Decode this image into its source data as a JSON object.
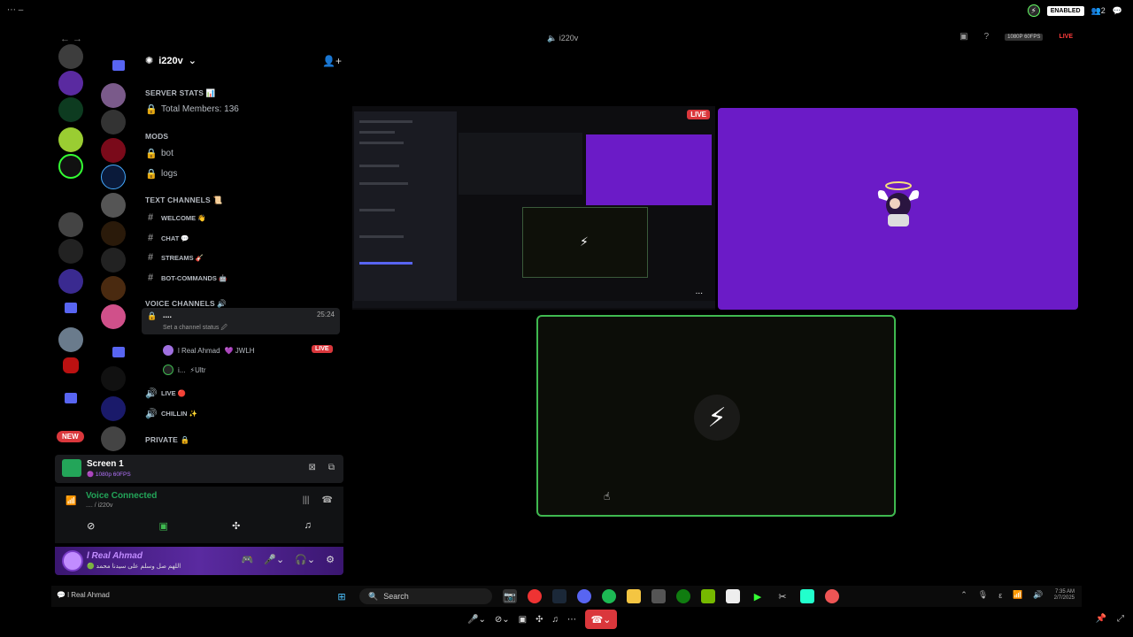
{
  "window": {
    "title": "i220v",
    "fps_badge": "1080P 60FPS",
    "live_badge": "LIVE"
  },
  "top_overlay": {
    "enabled_label": "ENABLED",
    "notif_count": "2"
  },
  "server": {
    "name": "i220v"
  },
  "categories": {
    "server_stats": "SERVER STATS 📊",
    "mods": "MODS",
    "text": "TEXT CHANNELS 📜",
    "voice": "VOICE CHANNELS 🔊",
    "private": "PRIVATE 🔒"
  },
  "channels": {
    "total_members": "Total Members: 136",
    "bot": "bot",
    "logs": "logs",
    "welcome": "WELCOME 👋",
    "chat": "CHAT 💬",
    "streams": "STREAMS 🎸",
    "bot_commands": "BOT-COMMANDS 🤖",
    "voice_active": "....",
    "voice_time": "25:24",
    "voice_status": "Set a channel status 🖉",
    "live": "LIVE 🔴",
    "chillin": "CHILLIN ✨"
  },
  "members": [
    {
      "name": "l Real Ahmad",
      "tag": "💜 JWLH",
      "live": "LIVE"
    },
    {
      "name": "i...",
      "tag": "⚡Ultr"
    }
  ],
  "new_badge": "NEW",
  "screen_panel": {
    "title": "Screen 1",
    "sub": "🟣 1080p 60FPS"
  },
  "voice_panel": {
    "label": "Voice Connected",
    "sub": ".... / i220v"
  },
  "user": {
    "name": "l Real Ahmad",
    "status": "🟢 اللهم صل وسلم على سيدنا محمد"
  },
  "stream": {
    "live": "LIVE",
    "more": "..."
  },
  "taskbar": {
    "left_label": "l Real Ahmad",
    "search_placeholder": "Search",
    "time": "7:35 AM",
    "date": "2/7/2025"
  },
  "colors": {
    "accent_purple": "#6b1bc7",
    "speaking_green": "#3fb950",
    "live_red": "#da373c",
    "blurple": "#5865f2"
  }
}
